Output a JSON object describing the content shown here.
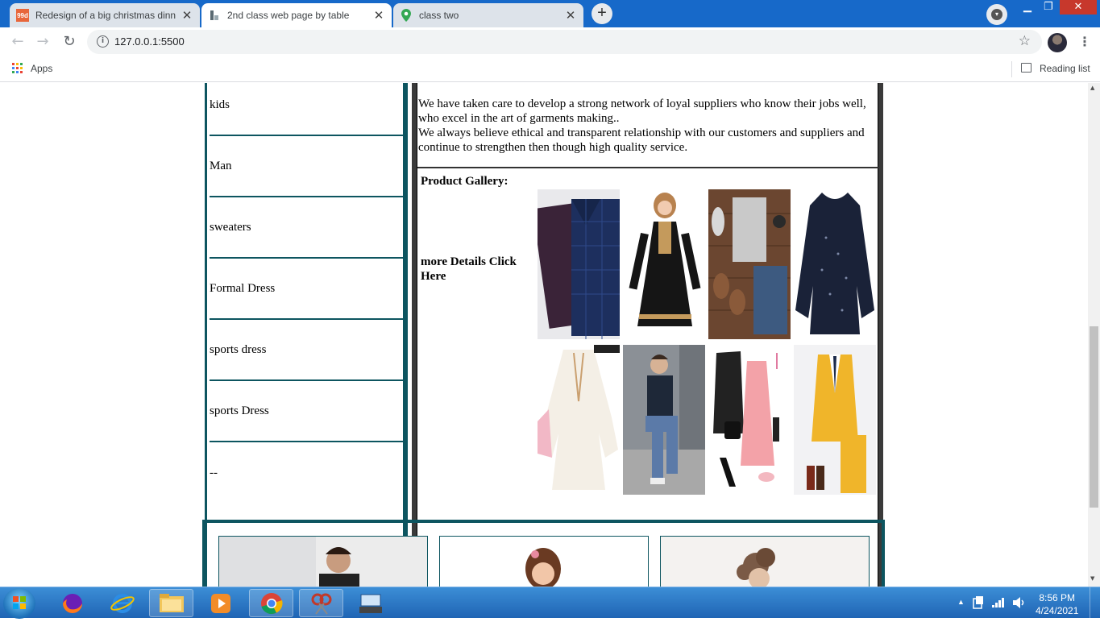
{
  "browser": {
    "tabs": [
      {
        "title": "Redesign of a big christmas dinn",
        "favicon": "99d"
      },
      {
        "title": "2nd class web page by table",
        "favicon": "page"
      },
      {
        "title": "class two",
        "favicon": "maps-pin"
      }
    ],
    "new_tab": "+",
    "window_controls": {
      "minimize": "▁",
      "restore": "❐",
      "close": "✕"
    },
    "nav": {
      "back": "←",
      "forward": "→",
      "reload": "↻"
    },
    "url": "127.0.0.1:5500",
    "info_icon": "i",
    "star_icon": "☆",
    "menu_icon": "⋮",
    "bookmarks": {
      "apps_label": "Apps",
      "reading_list_label": "Reading list"
    }
  },
  "page": {
    "categories": [
      "kids",
      "Man",
      "sweaters",
      "Formal Dress",
      "sports dress",
      "sports Dress",
      "--"
    ],
    "about_text": "We have taken care to develop a strong network of loyal suppliers who know their jobs well, who excel in the art of garments making..",
    "about_text_2": "We always believe ethical and transparent relationship with our customers and suppliers and continue to strengthen then though high quality service.",
    "gallery_title": "Product Gallery:",
    "more_details": "more Details Click Here",
    "products": [
      {
        "name": "checked shirts"
      },
      {
        "name": "girl black dress"
      },
      {
        "name": "men outfit flatlay"
      },
      {
        "name": "navy chiffon top"
      },
      {
        "name": "white embroidered tunic"
      },
      {
        "name": "man sitting street"
      },
      {
        "name": "women outfit pink dress"
      },
      {
        "name": "yellow suit"
      }
    ],
    "bottom_cards": [
      {
        "name": "man model card"
      },
      {
        "name": "girl model card"
      },
      {
        "name": "curly hair model card"
      }
    ]
  },
  "taskbar": {
    "time": "8:56 PM",
    "date": "4/24/2021",
    "tray_arrow": "▲"
  },
  "colors": {
    "chrome_blue": "#1769c9",
    "teal_border": "#0d5560",
    "dark_border": "#3a3a3a"
  }
}
